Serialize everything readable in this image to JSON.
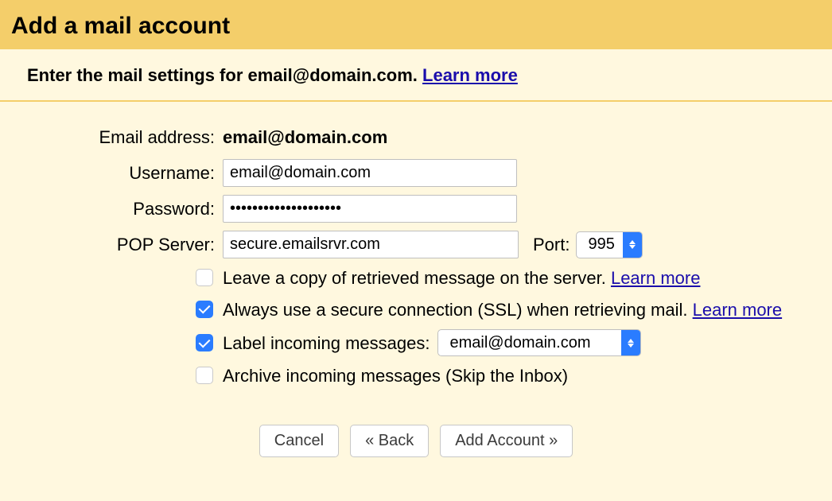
{
  "header": {
    "title": "Add a mail account"
  },
  "instruction": {
    "prefix": "Enter the mail settings for ",
    "email": "email@domain.com",
    "suffix": ". ",
    "learn_more": "Learn more"
  },
  "form": {
    "email_label": "Email address:",
    "email_value": "email@domain.com",
    "username_label": "Username:",
    "username_value": "email@domain.com",
    "password_label": "Password:",
    "password_value": "••••••••••••••••••••",
    "pop_label": "POP Server:",
    "pop_value": "secure.emailsrvr.com",
    "port_label": "Port:",
    "port_value": "995"
  },
  "options": {
    "leave_copy": {
      "checked": false,
      "text": "Leave a copy of retrieved message on the server. ",
      "learn_more": "Learn more"
    },
    "ssl": {
      "checked": true,
      "text": "Always use a secure connection (SSL) when retrieving mail. ",
      "learn_more": "Learn more"
    },
    "label_incoming": {
      "checked": true,
      "text": "Label incoming messages: ",
      "select_value": "email@domain.com"
    },
    "archive": {
      "checked": false,
      "text": "Archive incoming messages (Skip the Inbox)"
    }
  },
  "buttons": {
    "cancel": "Cancel",
    "back": "« Back",
    "add": "Add Account »"
  }
}
